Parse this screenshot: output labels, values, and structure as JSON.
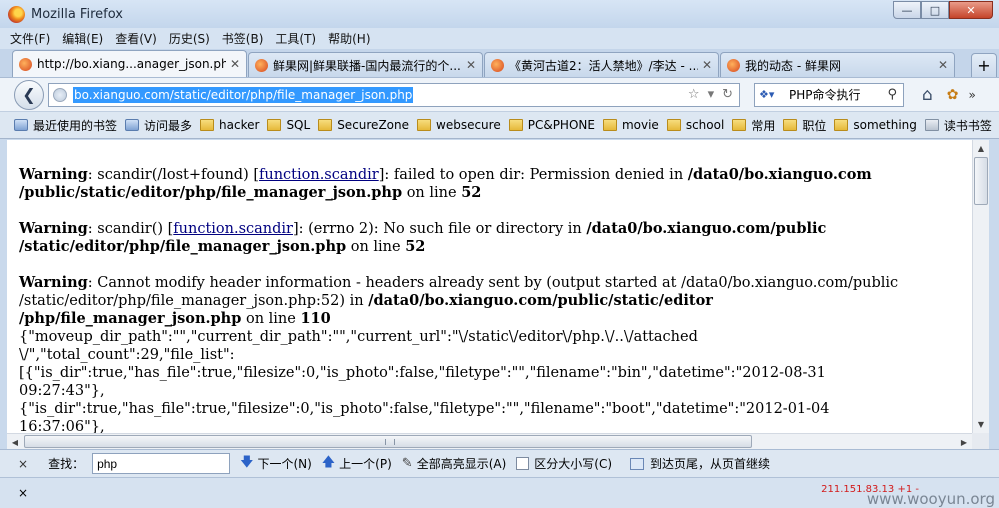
{
  "window": {
    "title": "Mozilla Firefox"
  },
  "menu": [
    "文件(F)",
    "编辑(E)",
    "查看(V)",
    "历史(S)",
    "书签(B)",
    "工具(T)",
    "帮助(H)"
  ],
  "tabs": [
    {
      "label": "http://bo.xiang...anager_json.php",
      "active": true
    },
    {
      "label": "鲜果网|鲜果联播-国内最流行的个...",
      "active": false
    },
    {
      "label": "《黄河古道2：活人禁地》/李达 - ...",
      "active": false
    },
    {
      "label": "我的动态 - 鲜果网",
      "active": false
    }
  ],
  "newtab_label": "+",
  "nav": {
    "url": "bo.xianguo.com/static/editor/php/file_manager_json.php",
    "search_value": "PHP命令执行"
  },
  "bookmarks": [
    {
      "label": "最近使用的书签",
      "icon": "star"
    },
    {
      "label": "访问最多",
      "icon": "star"
    },
    {
      "label": "hacker",
      "icon": "folder"
    },
    {
      "label": "SQL",
      "icon": "folder"
    },
    {
      "label": "SecureZone",
      "icon": "folder"
    },
    {
      "label": "websecure",
      "icon": "folder"
    },
    {
      "label": "PC&PHONE",
      "icon": "folder"
    },
    {
      "label": "movie",
      "icon": "folder"
    },
    {
      "label": "school",
      "icon": "folder"
    },
    {
      "label": "常用",
      "icon": "folder"
    },
    {
      "label": "职位",
      "icon": "folder"
    },
    {
      "label": "something",
      "icon": "folder"
    },
    {
      "label": "读书书签",
      "icon": "book"
    }
  ],
  "content": {
    "w1_label": "Warning",
    "w1_a": ": scandir(/lost+found) [",
    "w1_fn": "function.scandir",
    "w1_b": "]: failed to open dir: Permission denied in ",
    "w1_path1": "/data0/bo.xianguo.com",
    "w1_path2": "/public/static/editor/php/file_manager_json.php",
    "w1_online": " on line ",
    "w1_line": "52",
    "w2_label": "Warning",
    "w2_a": ": scandir() [",
    "w2_fn": "function.scandir",
    "w2_b": "]: (errno 2): No such file or directory in ",
    "w2_path1": "/data0/bo.xianguo.com/public",
    "w2_path2": "/static/editor/php/file_manager_json.php",
    "w2_online": " on line ",
    "w2_line": "52",
    "w3_label": "Warning",
    "w3_a": ": Cannot modify header information - headers already sent by (output started at /data0/bo.xianguo.com/public",
    "w3_b": "/static/editor/php/file_manager_json.php:52) in ",
    "w3_path1": "/data0/bo.xianguo.com/public/static/editor",
    "w3_path2": "/php/file_manager_json.php",
    "w3_online": " on line ",
    "w3_line": "110",
    "json_lines": [
      "{\"moveup_dir_path\":\"\",\"current_dir_path\":\"\",\"current_url\":\"\\/static\\/editor\\/php.\\/..\\/attached",
      "\\/\",\"total_count\":29,\"file_list\":",
      "[{\"is_dir\":true,\"has_file\":true,\"filesize\":0,\"is_photo\":false,\"filetype\":\"\",\"filename\":\"bin\",\"datetime\":\"2012-08-31",
      "09:27:43\"},",
      "{\"is_dir\":true,\"has_file\":true,\"filesize\":0,\"is_photo\":false,\"filetype\":\"\",\"filename\":\"boot\",\"datetime\":\"2012-01-04",
      "16:37:06\"},"
    ]
  },
  "findbar": {
    "close": "×",
    "label": "查找：",
    "value": "php",
    "next": "下一个(N)",
    "prev": "上一个(P)",
    "highlight": "全部高亮显示(A)",
    "matchcase": "区分大小写(C)",
    "wrap_status": "到达页尾，从页首继续"
  },
  "statusbar": {
    "close": "×",
    "ip": "211.151.83.13 +1 -",
    "watermark": "www.wooyun.org"
  }
}
